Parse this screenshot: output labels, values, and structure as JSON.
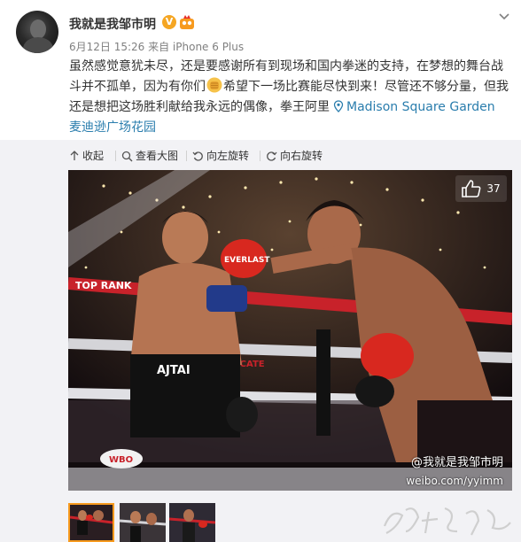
{
  "post": {
    "username": "我就是我邹市明",
    "verified_mark": "V",
    "meta": "6月12日 15:26 来自 iPhone 6 Plus",
    "text_part1": "虽然感觉意犹未尽，还是要感谢所有到现场和国内拳迷的支持，在梦想的舞台战斗并不孤单，因为有你们",
    "emoji": "fist-emoji",
    "text_part2": "希望下一场比赛能尽快到来！尽管还不够分量，但我还是想把这场胜利献给我永远的偶像，拳王阿里",
    "location_en": "Madison Square Garden",
    "location_cn": "麦迪逊广场花园"
  },
  "toolbar": {
    "collapse_label": "收起",
    "view_large_label": "查看大图",
    "rotate_left_label": "向左旋转",
    "rotate_right_label": "向右旋转"
  },
  "photo": {
    "like_count": "37",
    "watermark_handle": "@我就是我邹市明",
    "watermark_url": "weibo.com/yyimm",
    "fighter_trunks_text": "AJTAI",
    "ring_sponsor_text": "TOP RANK",
    "ring_sponsor_text_2": "TECATE",
    "glove_brand": "EVERLAST",
    "belt_badge": "WBO"
  },
  "thumbnails": [
    {
      "name": "thumb-1",
      "active": true
    },
    {
      "name": "thumb-2",
      "active": false
    },
    {
      "name": "thumb-3",
      "active": false
    }
  ],
  "colors": {
    "text": "#333333",
    "meta": "#808080",
    "link": "#2a7dad",
    "panel": "#f2f2f5",
    "accent": "#f79a1e",
    "glove_red": "#d8281f",
    "verified": "#f5a623"
  }
}
